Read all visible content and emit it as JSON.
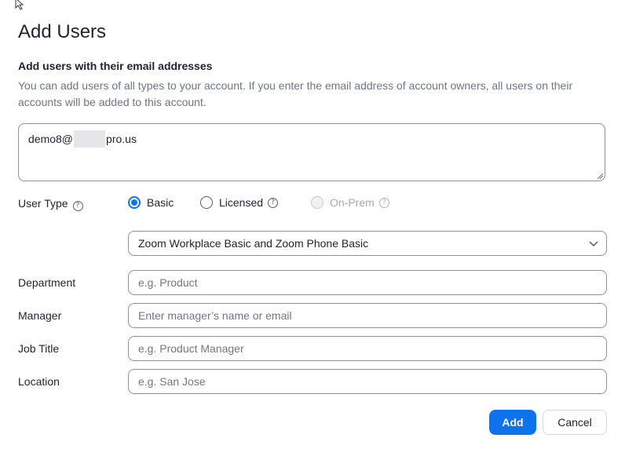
{
  "dialog": {
    "title": "Add Users",
    "subheading": "Add users with their email addresses",
    "description": "You can add users of all types to your account. If you enter the email address of account owners, all users on their accounts will be added to this account."
  },
  "email": {
    "value_prefix": "demo8@",
    "value_suffix": "pro.us"
  },
  "user_type": {
    "label": "User Type",
    "options": [
      {
        "label": "Basic",
        "selected": true,
        "disabled": false
      },
      {
        "label": "Licensed",
        "selected": false,
        "disabled": false
      },
      {
        "label": "On-Prem",
        "selected": false,
        "disabled": true
      }
    ]
  },
  "plan_select": {
    "value": "Zoom Workplace Basic and Zoom Phone Basic"
  },
  "fields": {
    "department": {
      "label": "Department",
      "placeholder": "e.g. Product"
    },
    "manager": {
      "label": "Manager",
      "placeholder": "Enter manager’s name or email"
    },
    "job_title": {
      "label": "Job Title",
      "placeholder": "e.g. Product Manager"
    },
    "location": {
      "label": "Location",
      "placeholder": "e.g. San Jose"
    }
  },
  "buttons": {
    "add": "Add",
    "cancel": "Cancel"
  },
  "colors": {
    "accent": "#0e72ed",
    "text": "#232333",
    "muted": "#6e7680",
    "border": "#909096"
  },
  "icons": {
    "help": "question-circle-icon",
    "chevron": "chevron-down-icon",
    "cursor": "mouse-pointer-icon"
  }
}
